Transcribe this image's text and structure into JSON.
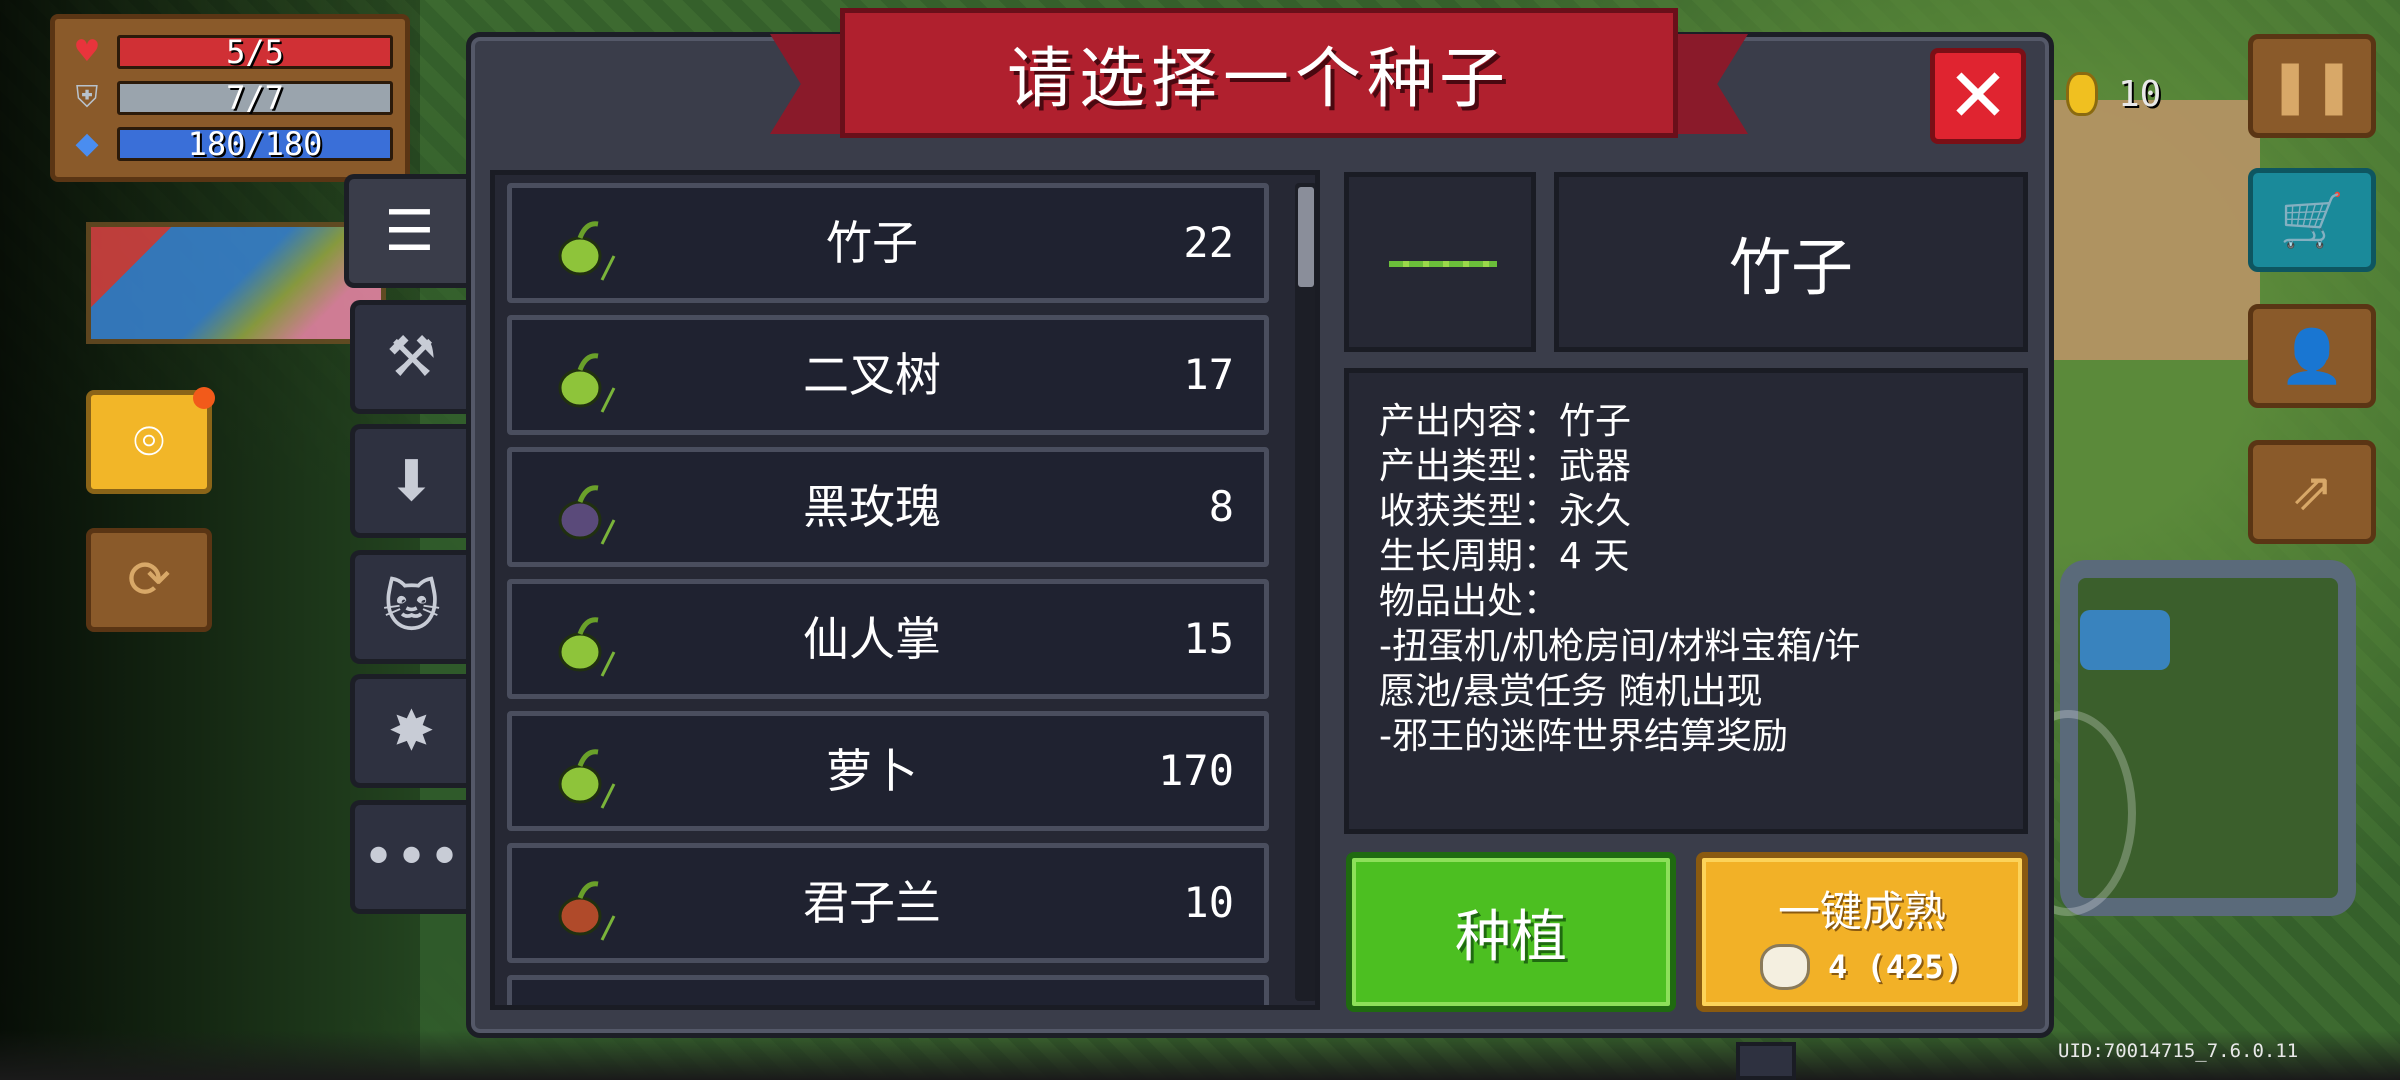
{
  "dialog": {
    "title": "请选择一个种子",
    "close_icon": "close-icon"
  },
  "tabs": [
    {
      "icon": "list-icon",
      "glyph": "☰",
      "active": true
    },
    {
      "icon": "hammer-icon",
      "glyph": "⚒",
      "active": false
    },
    {
      "icon": "down-arrow-icon",
      "glyph": "⬇",
      "active": false
    },
    {
      "icon": "cat-icon",
      "glyph": "🐱",
      "active": false
    },
    {
      "icon": "burst-icon",
      "glyph": "✸",
      "active": false
    },
    {
      "icon": "more-icon",
      "glyph": "•••",
      "active": false
    }
  ],
  "seeds": [
    {
      "name": "竹子",
      "count": "22",
      "icon": "bamboo-seed-icon"
    },
    {
      "name": "二叉树",
      "count": "17",
      "icon": "branch-tree-seed-icon"
    },
    {
      "name": "黑玫瑰",
      "count": "8",
      "icon": "black-rose-seed-icon"
    },
    {
      "name": "仙人掌",
      "count": "15",
      "icon": "cactus-seed-icon"
    },
    {
      "name": "萝卜",
      "count": "170",
      "icon": "carrot-seed-icon"
    },
    {
      "name": "君子兰",
      "count": "10",
      "icon": "clivia-seed-icon"
    }
  ],
  "detail": {
    "name": "竹子",
    "lines": [
      "产出内容：竹子",
      "产出类型：武器",
      "收获类型：永久",
      "生长周期：4 天",
      "物品出处：",
      "-扭蛋机/机枪房间/材料宝箱/许",
      "愿池/悬赏任务 随机出现",
      "-邪王的迷阵世界结算奖励"
    ]
  },
  "actions": {
    "plant_label": "种植",
    "ripen_label": "一键成熟",
    "ripen_cost": "4 (425)",
    "colors": {
      "plant": "#4cbf21",
      "ripen": "#f2b127"
    }
  },
  "stats": {
    "hp": "5/5",
    "armor": "7/7",
    "energy": "180/180",
    "colors": {
      "hp": "#d03035",
      "armor": "#9aa4ad",
      "energy": "#3a6fd8"
    }
  },
  "hud": {
    "coins": "10",
    "uid": "UID:70014715_7.6.0.11"
  }
}
